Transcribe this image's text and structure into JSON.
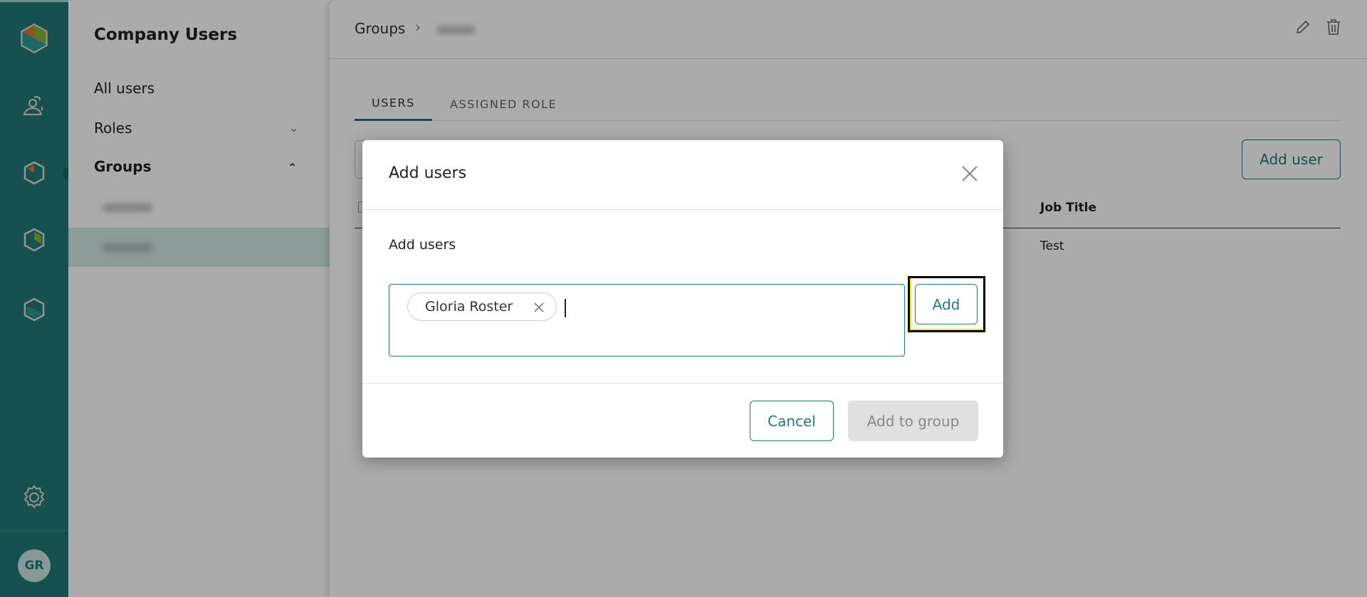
{
  "rail": {
    "icons": [
      "app-logo",
      "users-icon",
      "groups-hex-icon",
      "reports-hex-icon",
      "modules-hex-icon",
      "settings-gear-icon"
    ],
    "avatar": "GR",
    "accent": "#217a76"
  },
  "panel": {
    "title": "Company Users",
    "items": [
      {
        "label": "All users"
      },
      {
        "label": "Roles"
      },
      {
        "label": "Groups"
      }
    ]
  },
  "main": {
    "breadcrumb_root": "Groups",
    "tabs": [
      {
        "label": "USERS"
      },
      {
        "label": "ASSIGNED ROLE"
      }
    ],
    "add_user": "Add user",
    "table": {
      "headers": [
        "Job Title"
      ],
      "rows": [
        [
          "Test"
        ]
      ]
    }
  },
  "dialog": {
    "title": "Add users",
    "field_label": "Add users",
    "chips": [
      "Gloria Roster"
    ],
    "add": "Add",
    "cancel": "Cancel",
    "add_to_group": "Add to group"
  }
}
